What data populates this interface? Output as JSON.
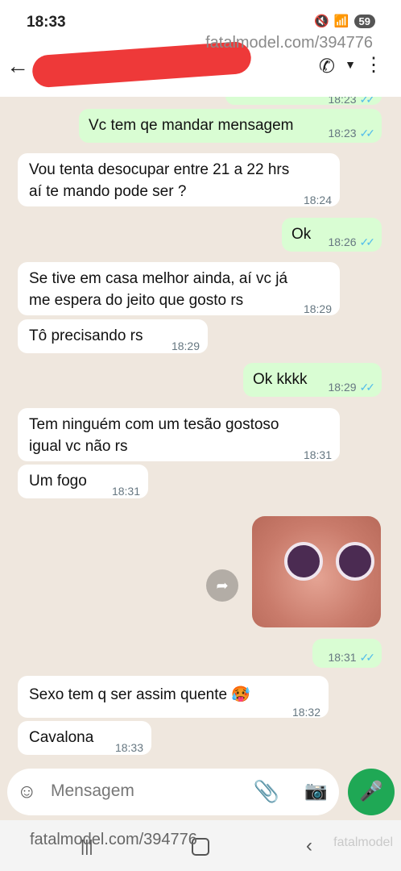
{
  "status_bar": {
    "time": "18:33",
    "battery": "59"
  },
  "watermark": {
    "top": "fatalmodel.com/394776",
    "bottom": "fatalmodel.com/394776",
    "logo": "fatalmodel"
  },
  "header": {
    "back_icon": "arrow-left-icon",
    "call_icon": "phone-icon",
    "more_icon": "more-vert-icon"
  },
  "messages": [
    {
      "dir": "out",
      "text": "Vc tem qe mandar mensagem",
      "time": "18:23",
      "ticks": "✓✓"
    },
    {
      "dir": "in",
      "text": "Vou tenta desocupar entre 21 a 22 hrs aí te mando pode ser ?",
      "time": "18:24"
    },
    {
      "dir": "out",
      "text": "Ok",
      "time": "18:26",
      "ticks": "✓✓"
    },
    {
      "dir": "in",
      "text": "Se tive em casa melhor ainda, aí vc já me espera do jeito que gosto rs",
      "time": "18:29"
    },
    {
      "dir": "in",
      "text": "Tô precisando rs",
      "time": "18:29"
    },
    {
      "dir": "out",
      "text": "Ok kkkk",
      "time": "18:29",
      "ticks": "✓✓"
    },
    {
      "dir": "in",
      "text": "Tem ninguém com um tesão gostoso igual vc não rs",
      "time": "18:31"
    },
    {
      "dir": "in",
      "text": "Um fogo",
      "time": "18:31"
    },
    {
      "dir": "out",
      "text": "",
      "time": "18:31",
      "ticks": "✓✓"
    },
    {
      "dir": "in",
      "text": "Sexo tem q ser assim quente 🥵",
      "time": "18:32"
    },
    {
      "dir": "in",
      "text": "Cavalona",
      "time": "18:33"
    }
  ],
  "partial_top": {
    "time": "18:23",
    "ticks": "✓✓"
  },
  "composer": {
    "placeholder": "Mensagem",
    "emoji_icon": "sticker-icon",
    "attach_icon": "paperclip-icon",
    "camera_icon": "camera-icon",
    "mic_icon": "mic-icon"
  },
  "colors": {
    "outgoing": "#d9fdd3",
    "incoming": "#ffffff",
    "accent": "#1fa855",
    "redaction": "#ee3939"
  }
}
